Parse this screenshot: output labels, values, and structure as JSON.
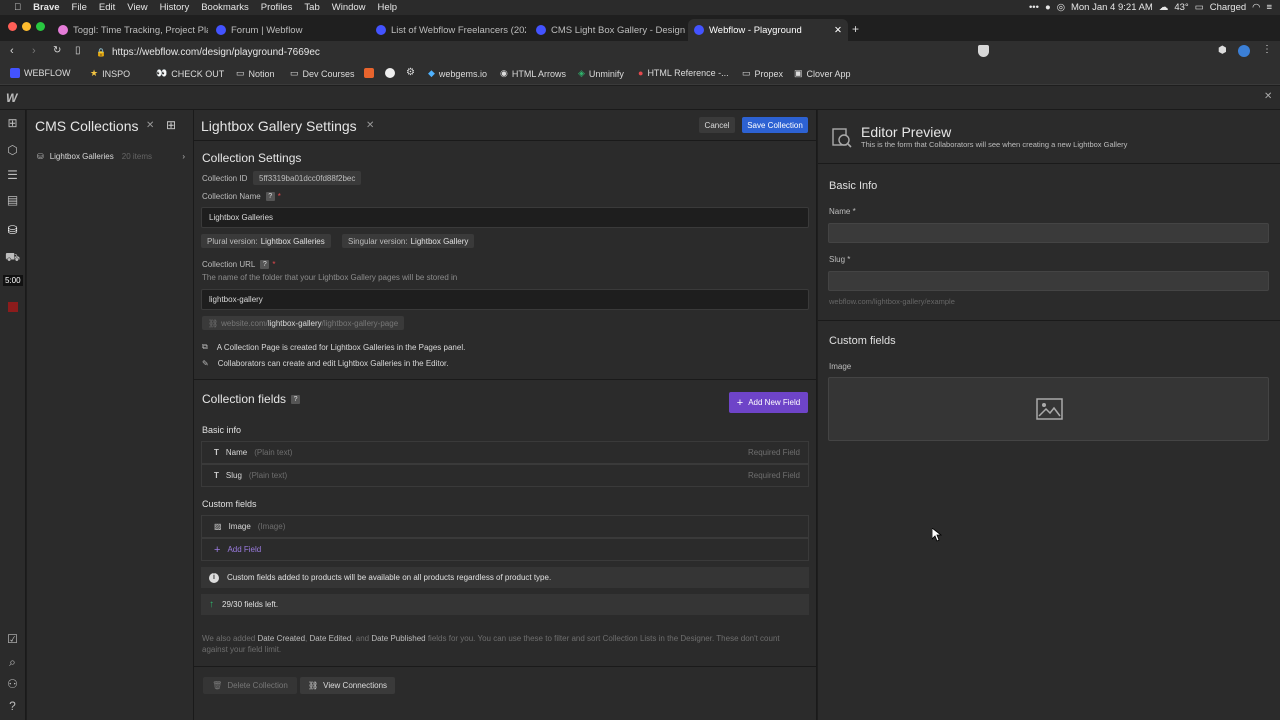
{
  "menubar": {
    "app": "Brave",
    "items": [
      "File",
      "Edit",
      "View",
      "History",
      "Bookmarks",
      "Profiles",
      "Tab",
      "Window",
      "Help"
    ],
    "clock": "Mon Jan 4  9:21 AM",
    "weather": "43°",
    "battery": "Charged"
  },
  "tabs": [
    {
      "label": "Toggl: Time Tracking, Project Planni",
      "color": "#e57cd8"
    },
    {
      "label": "Forum | Webflow",
      "color": "#4353ff"
    },
    {
      "label": "List of Webflow Freelancers (2021)",
      "color": "#4353ff"
    },
    {
      "label": "CMS Light Box Gallery - Design hel",
      "color": "#4353ff"
    },
    {
      "label": "Webflow - Playground",
      "color": "#4353ff"
    }
  ],
  "url": "https://webflow.com/design/playground-7669ec",
  "bookmarks": [
    "WEBFLOW",
    "INSPO",
    "CHECK OUT",
    "Notion",
    "Dev Courses",
    "webgems.io",
    "HTML Arrows",
    "Unminify",
    "HTML Reference -...",
    "Propex",
    "Clover App"
  ],
  "rail": {
    "timer": "5:00"
  },
  "cms": {
    "title": "CMS Collections",
    "collection_name": "Lightbox Galleries",
    "collection_count": "20 items"
  },
  "settings": {
    "title": "Lightbox Gallery Settings",
    "cancel": "Cancel",
    "save": "Save Collection",
    "section_title": "Collection Settings",
    "id_label": "Collection ID",
    "id_value": "5ff3319ba01dcc0fd88f2bec",
    "name_label": "Collection Name",
    "name_value": "Lightbox Galleries",
    "plural_label": "Plural version:",
    "plural_value": "Lightbox Galleries",
    "singular_label": "Singular version:",
    "singular_value": "Lightbox Gallery",
    "url_label": "Collection URL",
    "url_help": "The name of the folder that your Lightbox Gallery pages will be stored in",
    "url_value": "lightbox-gallery",
    "url_preview_prefix": "website.com/",
    "url_preview_bold": "lightbox-gallery",
    "url_preview_suffix": "/lightbox-gallery-page",
    "note1": "A Collection Page is created for Lightbox Galleries in the Pages panel.",
    "note2": "Collaborators can create and edit Lightbox Galleries in the Editor.",
    "fields_title": "Collection fields",
    "add_new_field": "Add New Field",
    "basic_info": "Basic info",
    "basic_fields": [
      {
        "icon": "T",
        "name": "Name",
        "type": "(Plain text)",
        "required": "Required Field"
      },
      {
        "icon": "T",
        "name": "Slug",
        "type": "(Plain text)",
        "required": "Required Field"
      }
    ],
    "custom_fields_title": "Custom fields",
    "custom_fields": [
      {
        "name": "Image",
        "type": "(Image)"
      }
    ],
    "add_field": "Add Field",
    "custom_notice": "Custom fields added to products will be available on all products regardless of product type.",
    "fields_left": "29/30 fields left.",
    "footer_pre": "We also added ",
    "footer_b1": "Date Created",
    "footer_m1": ", ",
    "footer_b2": "Date Edited",
    "footer_m2": ", and ",
    "footer_b3": "Date Published",
    "footer_post": " fields for you. You can use these to filter and sort Collection Lists in the Designer. These don't count against your field limit.",
    "delete": "Delete Collection",
    "view_connections": "View Connections"
  },
  "preview": {
    "title": "Editor Preview",
    "subtitle": "This is the form that Collaborators will see when creating a new Lightbox Gallery",
    "basic_info": "Basic Info",
    "name_label": "Name *",
    "slug_label": "Slug *",
    "slug_hint": "webflow.com/lightbox-gallery/example",
    "custom_fields": "Custom fields",
    "image_label": "Image"
  },
  "colors": {
    "accent_blue": "#2d62d3",
    "accent_purple": "#6e44c8",
    "required_red": "#e5484d"
  }
}
